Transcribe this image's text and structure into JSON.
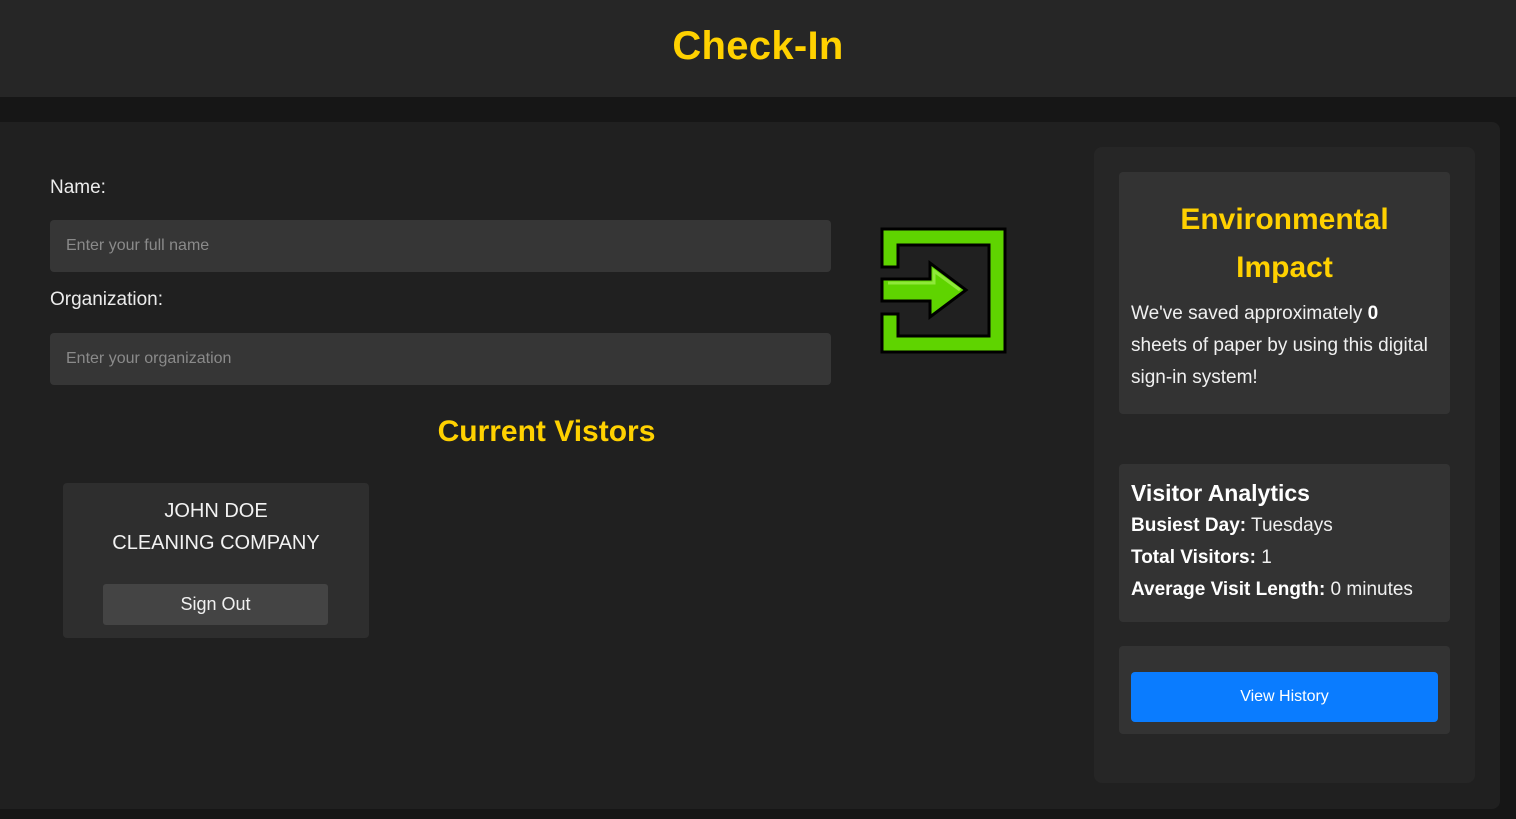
{
  "header": {
    "title": "Check-In"
  },
  "form": {
    "name_label": "Name:",
    "name_placeholder": "Enter your full name",
    "name_value": "",
    "org_label": "Organization:",
    "org_placeholder": "Enter your organization",
    "org_value": ""
  },
  "checkin_icon": {
    "icon": "sign-in-icon",
    "color": "#5fd400"
  },
  "visitors": {
    "title": "Current Vistors",
    "items": [
      {
        "name": "JOHN DOE",
        "organization": "CLEANING COMPANY",
        "signout_label": "Sign Out"
      }
    ]
  },
  "environment": {
    "title": "Environmental Impact",
    "text_before": "We've saved approximately ",
    "sheets_saved": "0",
    "text_after": " sheets of paper by using this digital sign-in system!"
  },
  "analytics": {
    "title": "Visitor Analytics",
    "busiest_day_label": "Busiest Day:",
    "busiest_day_value": " Tuesdays",
    "total_visitors_label": "Total Visitors:",
    "total_visitors_value": " 1",
    "avg_visit_label": "Average Visit Length:",
    "avg_visit_value": " 0 minutes"
  },
  "history": {
    "button_label": "View History"
  },
  "colors": {
    "accent": "#ffd100",
    "primary_button": "#0a7cff",
    "checkin_green": "#5fd400"
  }
}
